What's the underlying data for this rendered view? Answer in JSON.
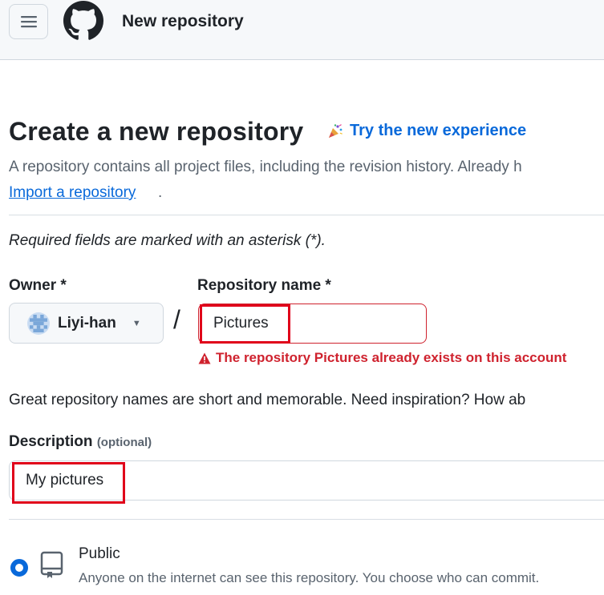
{
  "header": {
    "title": "New repository"
  },
  "page": {
    "title": "Create a new repository",
    "try_new_label": "Try the new experience",
    "intro_text": "A repository contains all project files, including the revision history. Already h",
    "import_link": "Import a repository",
    "import_suffix": ".",
    "required_note": "Required fields are marked with an asterisk (*)."
  },
  "form": {
    "owner_label": "Owner *",
    "owner_value": "Liyi-han",
    "separator": "/",
    "repo_label": "Repository name *",
    "repo_value": "Pictures",
    "repo_error": "The repository Pictures already exists on this account",
    "hint": "Great repository names are short and memorable. Need inspiration? How ab",
    "description_label": "Description",
    "description_optional": "(optional)",
    "description_value": "My pictures"
  },
  "visibility": {
    "public_label": "Public",
    "public_description": "Anyone on the internet can see this repository. You choose who can commit."
  },
  "colors": {
    "accent": "#0969da",
    "error": "#cf222e",
    "highlight": "#e0001a"
  }
}
